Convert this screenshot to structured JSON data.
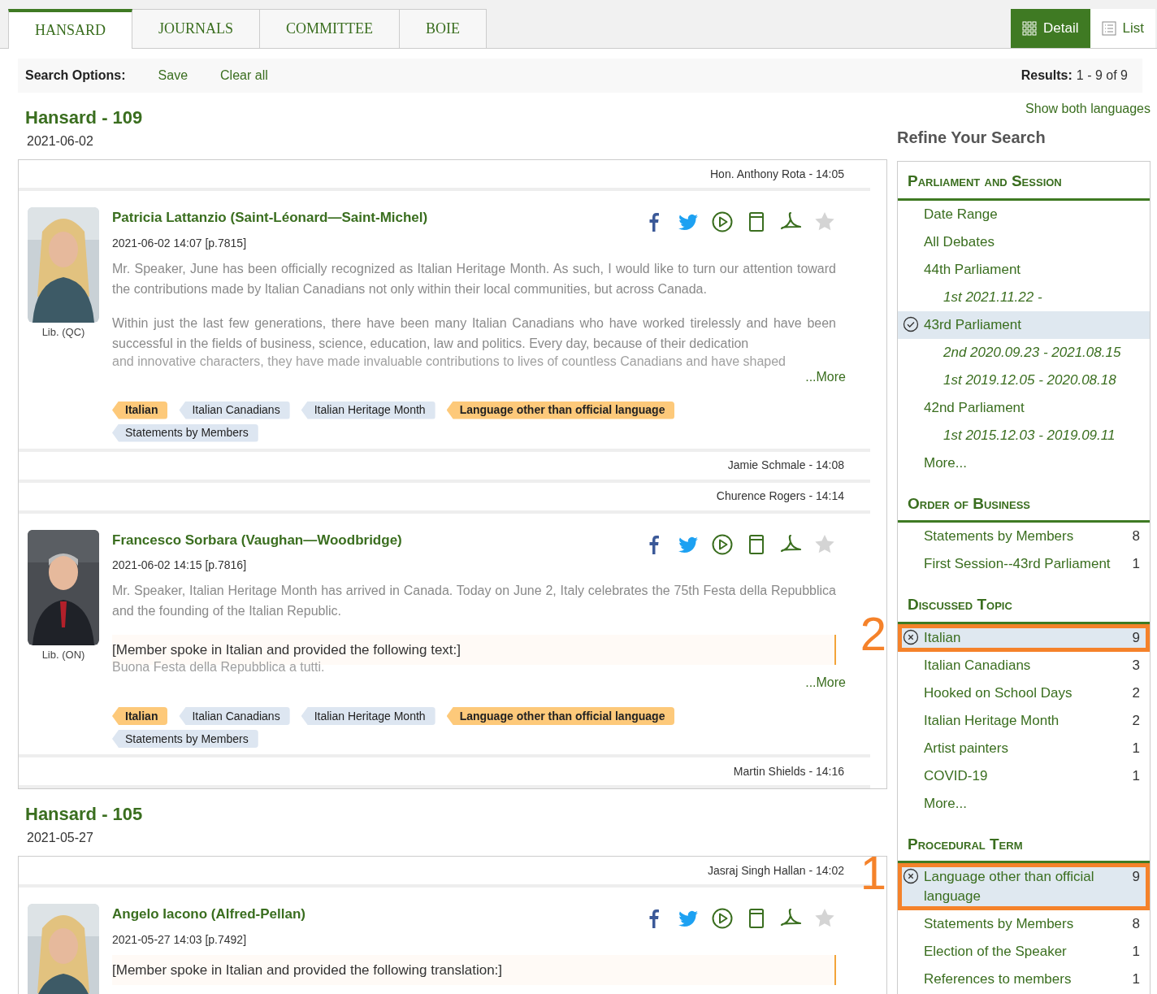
{
  "tabs": [
    {
      "label": "HANSARD",
      "selected": true
    },
    {
      "label": "JOURNALS",
      "selected": false
    },
    {
      "label": "COMMITTEE",
      "selected": false
    },
    {
      "label": "BOIE",
      "selected": false
    }
  ],
  "view_toggle": [
    {
      "label": "Detail",
      "kind": "grid",
      "selected": true
    },
    {
      "label": "List",
      "kind": "list",
      "selected": false
    }
  ],
  "search_options": {
    "label": "Search Options:",
    "actions": [
      "Save",
      "Clear all"
    ],
    "results_label": "Results:",
    "results": "1 - 9 of 9"
  },
  "show_both_languages": "Show both languages",
  "sittings": [
    {
      "title": "Hansard - 109",
      "date": "2021-06-02",
      "entries": [
        {
          "kind": "speaker-line",
          "text": "Hon. Anthony Rota - 14:05"
        },
        {
          "kind": "speech",
          "name": "Patricia Lattanzio (Saint-Léonard—Saint-Michel)",
          "party": "Lib. (QC)",
          "meta": "2021-06-02 14:07 [p.7815]",
          "paragraphs": [
            {
              "kind": "normal",
              "text": "Mr. Speaker, June has been officially recognized as Italian Heritage Month. As such, I would like to turn our attention toward the contributions made by Italian Canadians not only within their local communities, but across Canada."
            },
            {
              "kind": "normal",
              "text": "Within just the last few generations, there have been many Italian Canadians who have worked tirelessly and have been successful in the fields of business, science, education, law and politics. Every day, because of their dedication"
            },
            {
              "kind": "faded",
              "text": "and innovative characters, they have made invaluable contributions to lives of countless Canadians and have shaped"
            }
          ],
          "more": "...More",
          "tags": [
            {
              "label": "Italian",
              "selected": true
            },
            {
              "label": "Italian Canadians",
              "selected": false
            },
            {
              "label": "Italian Heritage Month",
              "selected": false
            },
            {
              "label": "Language other than official language",
              "selected": true
            },
            {
              "label": "Statements by Members",
              "selected": false
            }
          ]
        },
        {
          "kind": "speaker-line",
          "text": "Jamie Schmale - 14:08"
        },
        {
          "kind": "speaker-line",
          "text": "Churence Rogers - 14:14"
        },
        {
          "kind": "speech",
          "name": "Francesco Sorbara (Vaughan—Woodbridge)",
          "party": "Lib. (ON)",
          "meta": "2021-06-02 14:15 [p.7816]",
          "paragraphs": [
            {
              "kind": "normal",
              "text": "Mr. Speaker, Italian Heritage Month has arrived in Canada. Today on June 2, Italy celebrates the 75th Festa della Repubblica and the founding of the Italian Republic."
            },
            {
              "kind": "translation",
              "text": "[Member spoke in Italian and provided the following text:]"
            },
            {
              "kind": "faded",
              "text": "Buona Festa della Repubblica a tutti."
            }
          ],
          "more": "...More",
          "tags": [
            {
              "label": "Italian",
              "selected": true
            },
            {
              "label": "Italian Canadians",
              "selected": false
            },
            {
              "label": "Italian Heritage Month",
              "selected": false
            },
            {
              "label": "Language other than official language",
              "selected": true
            },
            {
              "label": "Statements by Members",
              "selected": false
            }
          ]
        },
        {
          "kind": "speaker-line",
          "text": "Martin Shields - 14:16"
        }
      ]
    },
    {
      "title": "Hansard - 105",
      "date": "2021-05-27",
      "entries": [
        {
          "kind": "speaker-line",
          "text": "Jasraj Singh Hallan - 14:02"
        },
        {
          "kind": "speech",
          "name": "Angelo Iacono (Alfred-Pellan)",
          "meta": "2021-05-27 14:03 [p.7492]",
          "paragraphs": [
            {
              "kind": "translation",
              "text": "[Member spoke in Italian and provided the following translation:]"
            }
          ]
        }
      ]
    }
  ],
  "refine": {
    "title": "Refine Your Search",
    "sections": [
      {
        "title": "Parliament and Session",
        "items": [
          {
            "label": "Date Range",
            "kind": "link",
            "selected": false
          },
          {
            "label": "All Debates",
            "kind": "link",
            "selected": false
          },
          {
            "label": "44th Parliament",
            "kind": "link",
            "selected": false
          },
          {
            "label": "1st 2021.11.22 -",
            "kind": "session",
            "selected": false
          },
          {
            "label": "43rd Parliament",
            "kind": "link",
            "selected": true
          },
          {
            "label": "2nd 2020.09.23 - 2021.08.15",
            "kind": "session",
            "selected": false
          },
          {
            "label": "1st 2019.12.05 - 2020.08.18",
            "kind": "session",
            "selected": false
          },
          {
            "label": "42nd Parliament",
            "kind": "link",
            "selected": false
          },
          {
            "label": "1st 2015.12.03 - 2019.09.11",
            "kind": "session",
            "selected": false
          },
          {
            "label": "More...",
            "kind": "link",
            "selected": false
          }
        ]
      },
      {
        "title": "Order of Business",
        "items": [
          {
            "label": "Statements by Members",
            "kind": "link",
            "count": "8",
            "selected": false
          },
          {
            "label": "First Session--43rd Parliament",
            "kind": "link",
            "count": "1",
            "selected": false
          }
        ]
      },
      {
        "title": "Discussed Topic",
        "items": [
          {
            "label": "Italian",
            "kind": "link",
            "count": "9",
            "selected": true,
            "annotation": "2"
          },
          {
            "label": "Italian Canadians",
            "kind": "link",
            "count": "3",
            "selected": false
          },
          {
            "label": "Hooked on School Days",
            "kind": "link",
            "count": "2",
            "selected": false
          },
          {
            "label": "Italian Heritage Month",
            "kind": "link",
            "count": "2",
            "selected": false
          },
          {
            "label": "Artist painters",
            "kind": "link",
            "count": "1",
            "selected": false
          },
          {
            "label": "COVID-19",
            "kind": "link",
            "count": "1",
            "selected": false
          },
          {
            "label": "More...",
            "kind": "link",
            "selected": false
          }
        ]
      },
      {
        "title": "Procedural Term",
        "items": [
          {
            "label": "Language other than official language",
            "kind": "link",
            "count": "9",
            "selected": true,
            "annotation": "1"
          },
          {
            "label": "Statements by Members",
            "kind": "link",
            "count": "8",
            "selected": false
          },
          {
            "label": "Election of the Speaker",
            "kind": "link",
            "count": "1",
            "selected": false
          },
          {
            "label": "References to members",
            "kind": "link",
            "count": "1",
            "selected": false
          }
        ]
      }
    ]
  }
}
